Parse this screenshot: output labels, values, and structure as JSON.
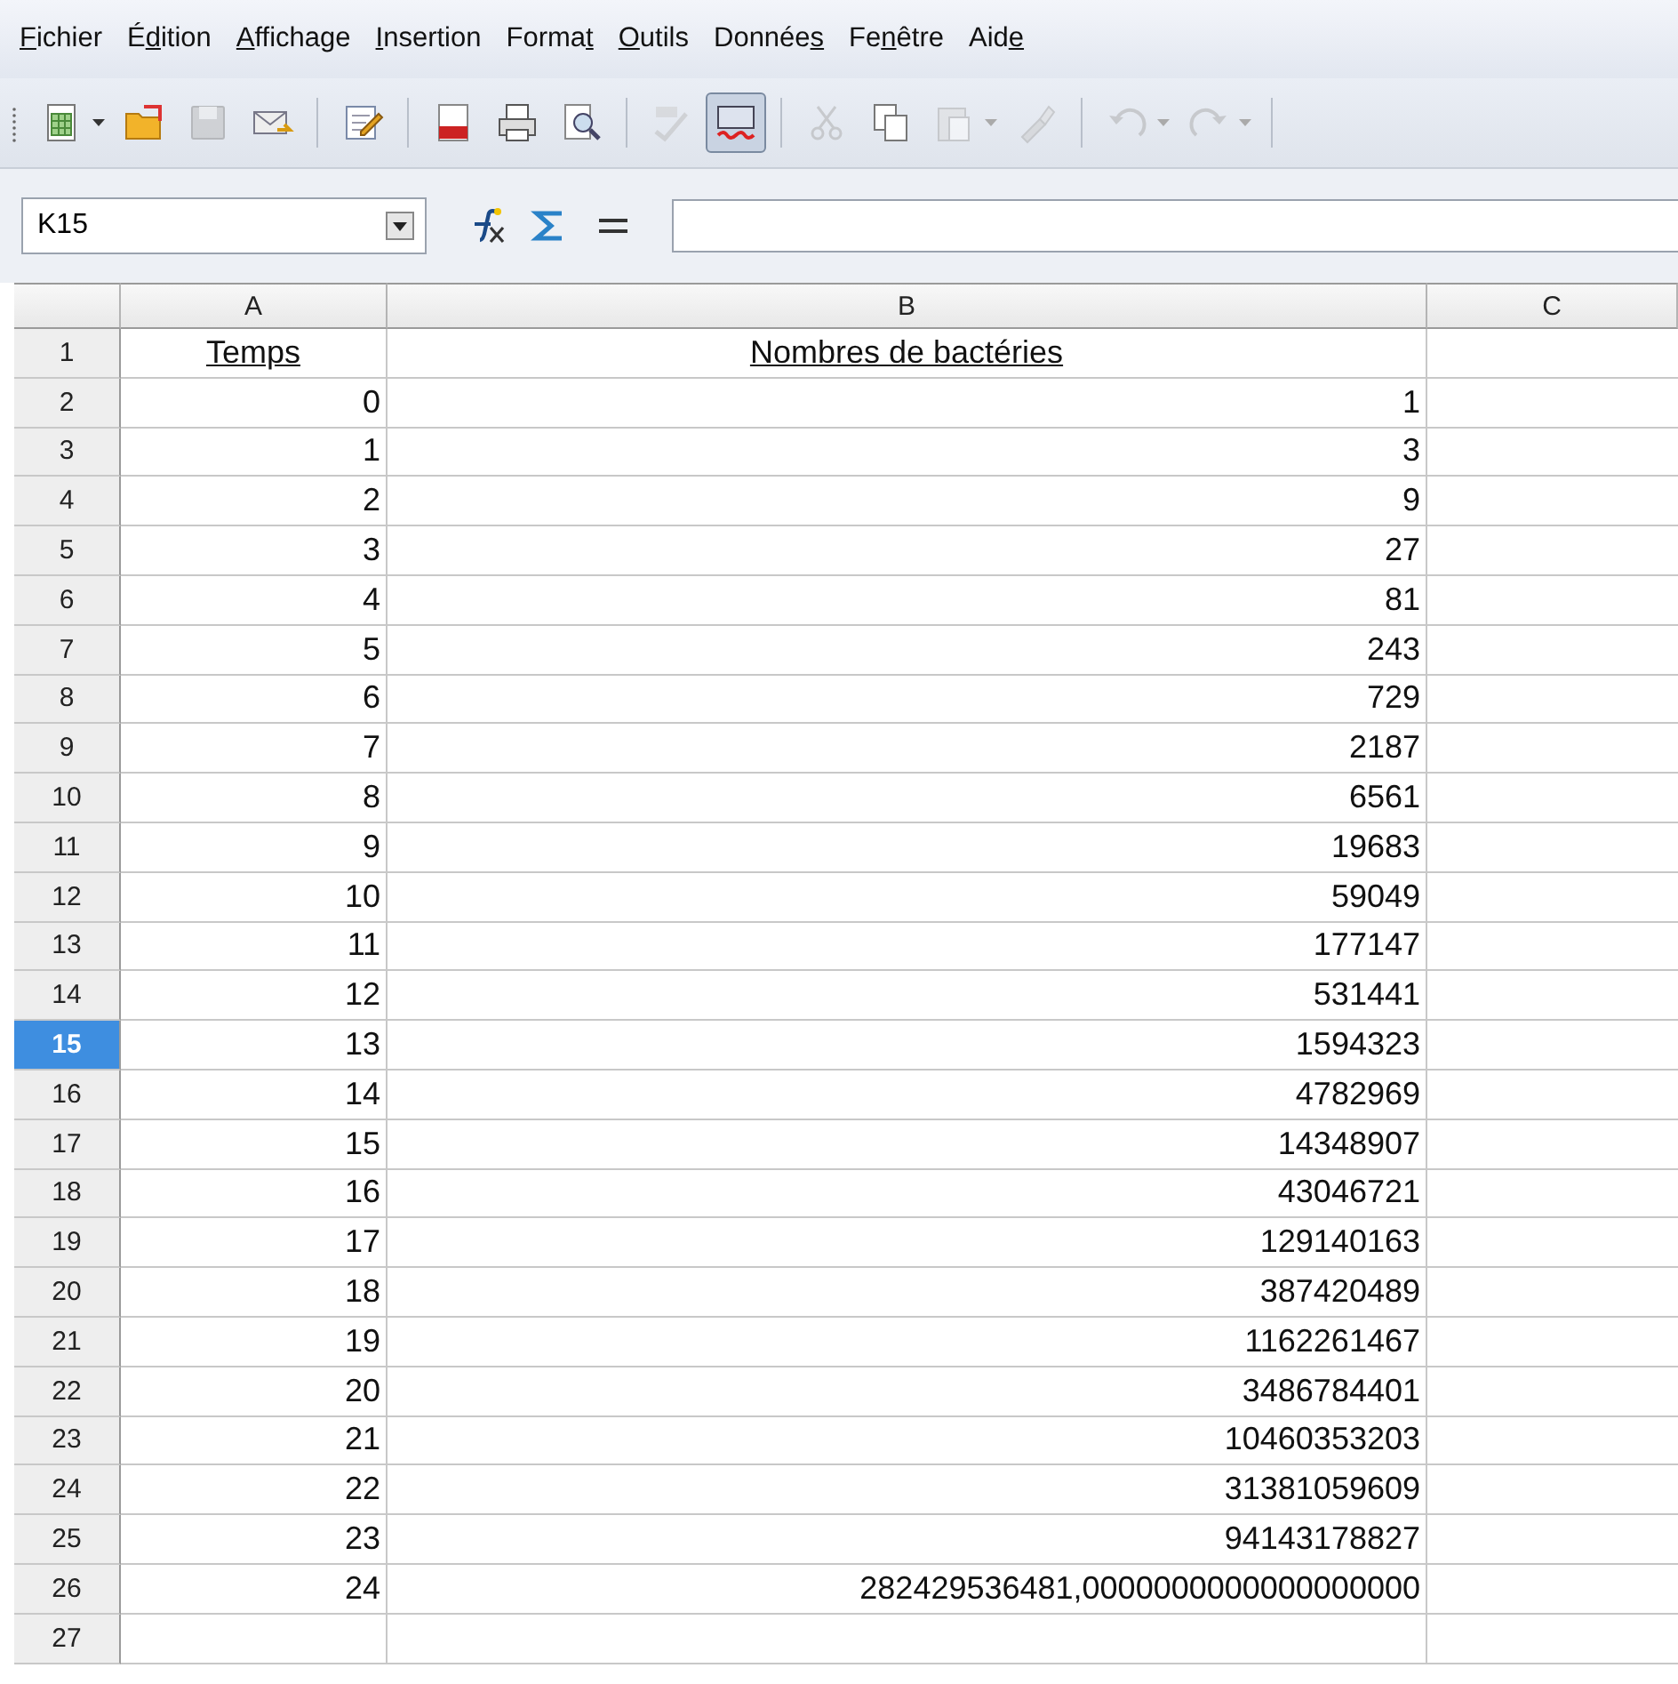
{
  "menu": [
    {
      "key": "F",
      "post": "ichier"
    },
    {
      "pre": "É",
      "key": "d",
      "post": "ition"
    },
    {
      "key": "A",
      "post": "ffichage"
    },
    {
      "key": "I",
      "post": "nsertion"
    },
    {
      "pre": "Forma",
      "key": "t"
    },
    {
      "key": "O",
      "post": "utils"
    },
    {
      "pre": "Donnée",
      "key": "s"
    },
    {
      "pre": "Fe",
      "key": "n",
      "post": "être"
    },
    {
      "pre": "Aid",
      "key": "e"
    }
  ],
  "toolbar": [
    {
      "kind": "new",
      "dropdown": true,
      "disabled": false,
      "pressed": false
    },
    {
      "kind": "open",
      "dropdown": false,
      "disabled": false,
      "pressed": false
    },
    {
      "kind": "save",
      "dropdown": false,
      "disabled": true,
      "pressed": false
    },
    {
      "kind": "mail",
      "dropdown": false,
      "disabled": false,
      "pressed": false
    },
    {
      "kind": "separator"
    },
    {
      "kind": "edit",
      "dropdown": false,
      "disabled": false,
      "pressed": false
    },
    {
      "kind": "separator"
    },
    {
      "kind": "pdf",
      "dropdown": false,
      "disabled": false,
      "pressed": false
    },
    {
      "kind": "print",
      "dropdown": false,
      "disabled": false,
      "pressed": false
    },
    {
      "kind": "preview",
      "dropdown": false,
      "disabled": false,
      "pressed": false
    },
    {
      "kind": "separator"
    },
    {
      "kind": "spell",
      "dropdown": false,
      "disabled": true,
      "pressed": false
    },
    {
      "kind": "autospell",
      "dropdown": false,
      "disabled": false,
      "pressed": true
    },
    {
      "kind": "separator"
    },
    {
      "kind": "cut",
      "dropdown": false,
      "disabled": true,
      "pressed": false
    },
    {
      "kind": "copy",
      "dropdown": false,
      "disabled": false,
      "pressed": false
    },
    {
      "kind": "paste",
      "dropdown": true,
      "disabled": true,
      "pressed": false
    },
    {
      "kind": "brush",
      "dropdown": false,
      "disabled": true,
      "pressed": false
    },
    {
      "kind": "separator"
    },
    {
      "kind": "undo",
      "dropdown": true,
      "disabled": true,
      "pressed": false
    },
    {
      "kind": "redo",
      "dropdown": true,
      "disabled": true,
      "pressed": false
    },
    {
      "kind": "separator"
    }
  ],
  "formula_bar": {
    "cell_reference": "K15"
  },
  "columns": [
    "A",
    "B",
    "C"
  ],
  "rows": [
    {
      "number": "1",
      "kind": "heading",
      "selected": false,
      "a": "Temps",
      "b": "Nombres de bactéries"
    },
    {
      "number": "2",
      "kind": "number",
      "selected": false,
      "a": "0",
      "b": "1"
    },
    {
      "number": "3",
      "kind": "number",
      "selected": false,
      "a": "1",
      "b": "3"
    },
    {
      "number": "4",
      "kind": "number",
      "selected": false,
      "a": "2",
      "b": "9"
    },
    {
      "number": "5",
      "kind": "number",
      "selected": false,
      "a": "3",
      "b": "27"
    },
    {
      "number": "6",
      "kind": "number",
      "selected": false,
      "a": "4",
      "b": "81"
    },
    {
      "number": "7",
      "kind": "number",
      "selected": false,
      "a": "5",
      "b": "243"
    },
    {
      "number": "8",
      "kind": "number",
      "selected": false,
      "a": "6",
      "b": "729"
    },
    {
      "number": "9",
      "kind": "number",
      "selected": false,
      "a": "7",
      "b": "2187"
    },
    {
      "number": "10",
      "kind": "number",
      "selected": false,
      "a": "8",
      "b": "6561"
    },
    {
      "number": "11",
      "kind": "number",
      "selected": false,
      "a": "9",
      "b": "19683"
    },
    {
      "number": "12",
      "kind": "number",
      "selected": false,
      "a": "10",
      "b": "59049"
    },
    {
      "number": "13",
      "kind": "number",
      "selected": false,
      "a": "11",
      "b": "177147"
    },
    {
      "number": "14",
      "kind": "number",
      "selected": false,
      "a": "12",
      "b": "531441"
    },
    {
      "number": "15",
      "kind": "number",
      "selected": true,
      "a": "13",
      "b": "1594323"
    },
    {
      "number": "16",
      "kind": "number",
      "selected": false,
      "a": "14",
      "b": "4782969"
    },
    {
      "number": "17",
      "kind": "number",
      "selected": false,
      "a": "15",
      "b": "14348907"
    },
    {
      "number": "18",
      "kind": "number",
      "selected": false,
      "a": "16",
      "b": "43046721"
    },
    {
      "number": "19",
      "kind": "number",
      "selected": false,
      "a": "17",
      "b": "129140163"
    },
    {
      "number": "20",
      "kind": "number",
      "selected": false,
      "a": "18",
      "b": "387420489"
    },
    {
      "number": "21",
      "kind": "number",
      "selected": false,
      "a": "19",
      "b": "1162261467"
    },
    {
      "number": "22",
      "kind": "number",
      "selected": false,
      "a": "20",
      "b": "3486784401"
    },
    {
      "number": "23",
      "kind": "number",
      "selected": false,
      "a": "21",
      "b": "10460353203"
    },
    {
      "number": "24",
      "kind": "number",
      "selected": false,
      "a": "22",
      "b": "31381059609"
    },
    {
      "number": "25",
      "kind": "number",
      "selected": false,
      "a": "23",
      "b": "94143178827"
    },
    {
      "number": "26",
      "kind": "number",
      "selected": false,
      "a": "24",
      "b": "282429536481,0000000000000000000"
    },
    {
      "number": "27",
      "kind": "empty",
      "selected": false
    }
  ]
}
